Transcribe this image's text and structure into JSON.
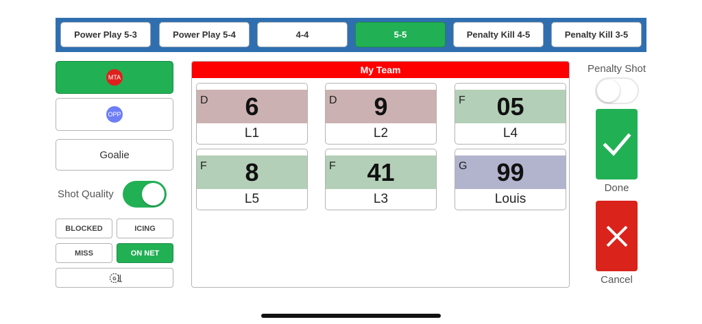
{
  "strength_tabs": [
    {
      "label": "Power Play 5-3",
      "active": false
    },
    {
      "label": "Power Play 5-4",
      "active": false
    },
    {
      "label": "4-4",
      "active": false
    },
    {
      "label": "5-5",
      "active": true
    },
    {
      "label": "Penalty Kill 4-5",
      "active": false
    },
    {
      "label": "Penalty Kill 3-5",
      "active": false
    }
  ],
  "teams": {
    "mta": {
      "label": "MTA",
      "selected": true,
      "color": "#e0201c"
    },
    "opp": {
      "label": "OPP",
      "selected": false,
      "color": "#6d7ef6"
    }
  },
  "goalie_label": "Goalie",
  "shot_quality": {
    "label": "Shot Quality",
    "on": true
  },
  "shot_results": {
    "blocked": "BLOCKED",
    "icing": "ICING",
    "miss": "MISS",
    "on_net": "ON NET",
    "selected": "ON NET"
  },
  "goal_icon": "goal-icon",
  "roster": {
    "title": "My Team",
    "players": [
      {
        "pos": "D",
        "number": "6",
        "name": "L1",
        "color": "#cbb1b1"
      },
      {
        "pos": "D",
        "number": "9",
        "name": "L2",
        "color": "#cbb1b1"
      },
      {
        "pos": "F",
        "number": "05",
        "name": "L4",
        "color": "#b3cfb7"
      },
      {
        "pos": "F",
        "number": "8",
        "name": "L5",
        "color": "#b3cfb7"
      },
      {
        "pos": "F",
        "number": "41",
        "name": "L3",
        "color": "#b3cfb7"
      },
      {
        "pos": "G",
        "number": "99",
        "name": "Louis",
        "color": "#b2b3cd"
      }
    ]
  },
  "penalty_shot": {
    "label": "Penalty Shot",
    "on": false
  },
  "done_label": "Done",
  "cancel_label": "Cancel",
  "colors": {
    "accent_green": "#22b055",
    "bar_blue": "#2f6fb0",
    "cancel_red": "#d9231b",
    "header_red": "#ff0000"
  }
}
